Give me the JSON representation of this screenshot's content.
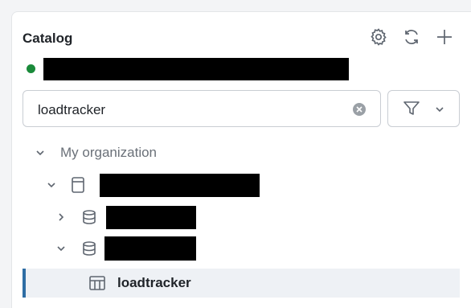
{
  "catalog": {
    "title": "Catalog",
    "status_color": "#1a8a3a",
    "header_icons": [
      "gear-icon",
      "refresh-icon",
      "plus-icon"
    ]
  },
  "search": {
    "value": "loadtracker"
  },
  "filter": {
    "icons": [
      "filter-icon",
      "chevron-down-icon"
    ]
  },
  "tree": {
    "organization_label": "My organization",
    "selected_table_label": "loadtracker"
  },
  "colors": {
    "accent": "#2e6da4",
    "selected_bg": "#eef1f5"
  }
}
